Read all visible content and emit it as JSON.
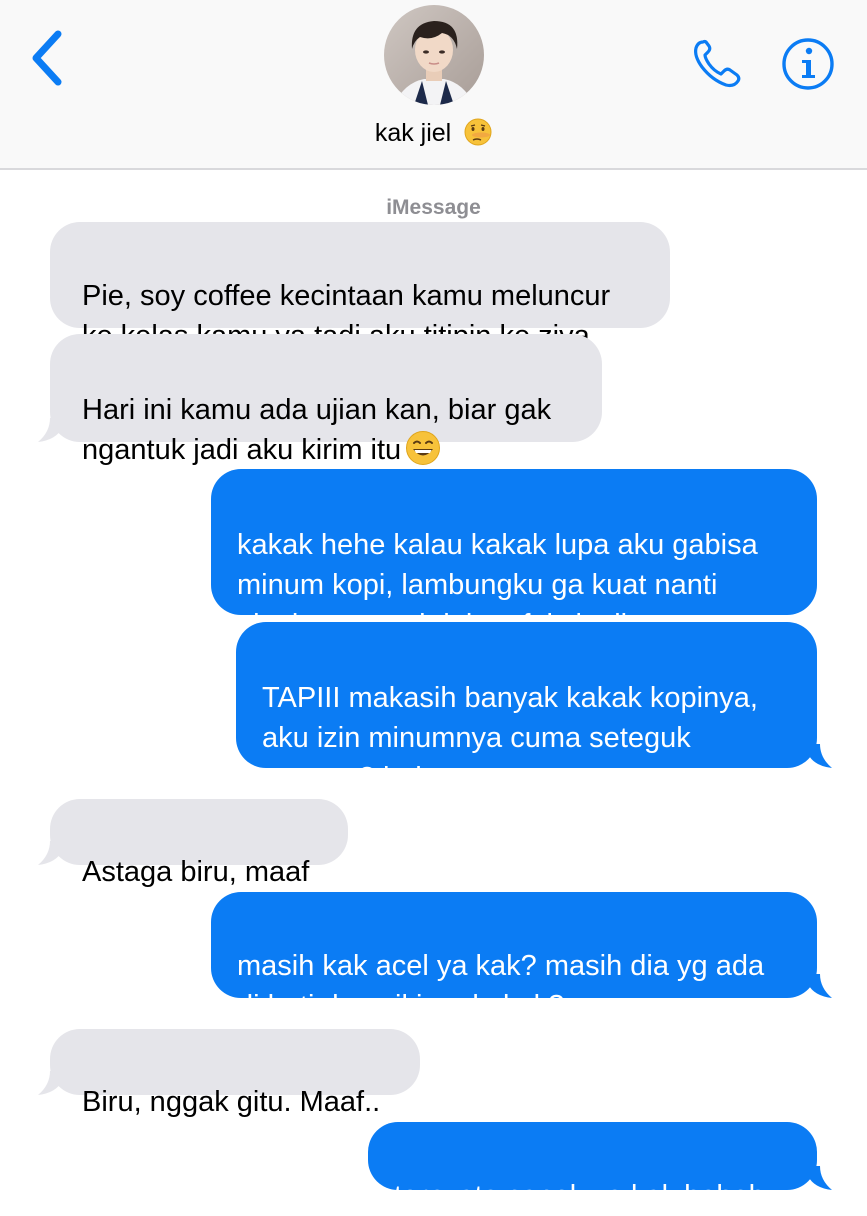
{
  "header": {
    "contact_name": "kak jiel",
    "name_emoji": "lying-face-emoji"
  },
  "service_label": "iMessage",
  "messages": [
    {
      "from": "them",
      "text": "Pie, soy coffee kecintaan kamu meluncur\nke kelas kamu ya tadi aku titipin ke ziva"
    },
    {
      "from": "them",
      "text": "Hari ini kamu ada ujian kan, biar gak\nngantuk jadi aku kirim itu",
      "emoji": "grinning-face-emoji"
    },
    {
      "from": "me",
      "text": "kakak hehe kalau kakak lupa aku gabisa\nminum kopi, lambungku ga kuat nanti\naku kena omel dokter faiz lagii"
    },
    {
      "from": "me",
      "text": "TAPIII makasih banyak kakak kopinya,\naku izin minumnya cuma seteguk\ngapapa? hehe"
    },
    {
      "from": "them",
      "text": "Astaga biru, maaf"
    },
    {
      "from": "me",
      "text": "masih kak acel ya kak? masih dia yg ada\ndi hati dan pikiran kakak?"
    },
    {
      "from": "them",
      "text": "Biru, nggak gitu. Maaf.."
    },
    {
      "from": "me",
      "text": "ternyata capek ya kak heheh"
    }
  ],
  "colors": {
    "accent": "#0b7cf4",
    "incoming_bubble": "#e5e5ea",
    "header_bg": "#f9f9f9",
    "muted_text": "#8e8e93"
  },
  "icons": [
    "chevron-left-icon",
    "phone-icon",
    "info-icon"
  ]
}
